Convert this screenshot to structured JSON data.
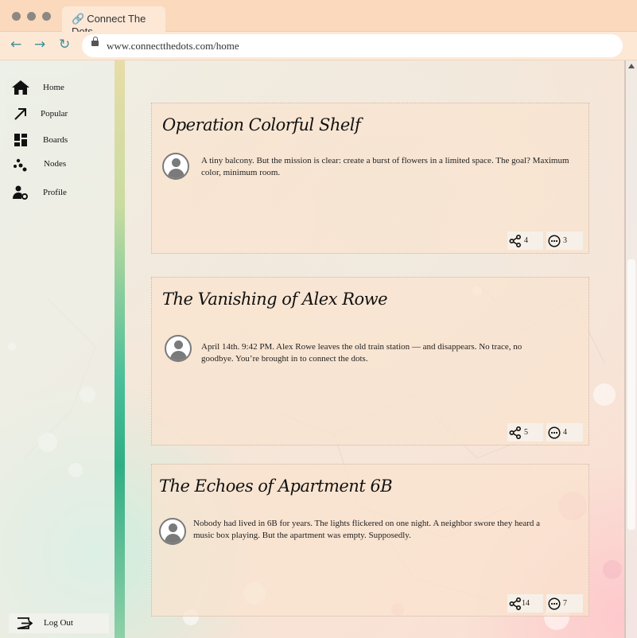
{
  "browser": {
    "tab_title": "Connect The Dots",
    "url": "www.connectthedots.com/home",
    "back_glyph": "←",
    "forward_glyph": "→",
    "reload_glyph": "↻"
  },
  "sidebar": {
    "items": [
      {
        "label": "Home",
        "icon": "home-icon"
      },
      {
        "label": "Popular",
        "icon": "arrow-up-right-icon"
      },
      {
        "label": "Boards",
        "icon": "dashboard-icon"
      },
      {
        "label": "Nodes",
        "icon": "nodes-icon"
      },
      {
        "label": "Profile",
        "icon": "profile-settings-icon"
      }
    ],
    "logout_label": "Log Out"
  },
  "posts": [
    {
      "title": "Operation Colorful Shelf",
      "body": "A tiny balcony. But the mission is clear: create a burst of flowers in a limited space. The goal? Maximum color, minimum room.",
      "shares": "4",
      "comments": "3"
    },
    {
      "title": "The Vanishing of Alex Rowe",
      "body": "April 14th. 9:42 PM. Alex Rowe leaves the old train station — and disappears. No trace, no goodbye. You’re brought in to connect the dots.",
      "shares": "5",
      "comments": "4"
    },
    {
      "title": "The Echoes of Apartment 6B",
      "body": "Nobody had lived in 6B for years. The lights flickered on one night. A neighbor swore they heard a music box playing. But the apartment was empty. Supposedly.",
      "shares": "14",
      "comments": "7"
    }
  ],
  "colors": {
    "accent": "#3b8f98",
    "titlebar": "#fbd9bd",
    "card": "#fae3ce"
  }
}
